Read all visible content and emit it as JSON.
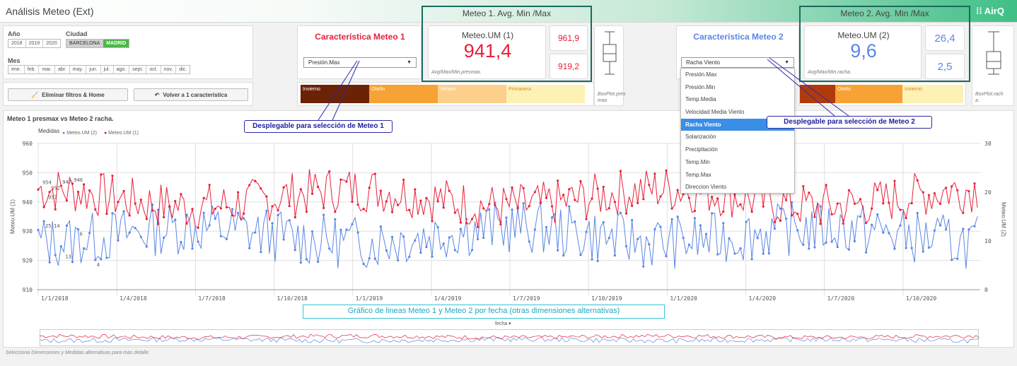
{
  "app": {
    "title": "Análisis Meteo (Ext)",
    "logo": "AirQ"
  },
  "filters": {
    "year_label": "Año",
    "years": [
      "2018",
      "2019",
      "2020"
    ],
    "city_label": "Ciudad",
    "cities": [
      "BARCELONA",
      "MADRID"
    ],
    "selected_city": "MADRID",
    "month_label": "Mes",
    "months": [
      "ene.",
      "feb.",
      "mar.",
      "abr.",
      "may.",
      "jun.",
      "jul.",
      "ago.",
      "sept.",
      "oct.",
      "nov.",
      "dic."
    ]
  },
  "buttons": {
    "clear": "Eliminar filtros & Home",
    "back": "Volver a 1 característica"
  },
  "meteo1": {
    "header": "Meteo 1. Avg. Min /Max",
    "char_title": "Característica Meteo 1",
    "selected": "Presión.Max",
    "kpi_label": "Meteo.UM (1)",
    "kpi_value": "941,4",
    "max": "961,9",
    "min": "919,2",
    "caption": "Avg/Max/Min.presmax.",
    "boxplot_caption": "BoxPlot.pres max.",
    "seasons": [
      "Invierno",
      "Otoño",
      "Verano",
      "Primavera"
    ],
    "color": "#e8203a"
  },
  "meteo2": {
    "header": "Meteo 2. Avg. Min /Max",
    "char_title": "Característica Meteo 2",
    "selected": "Racha Viento",
    "kpi_label": "Meteo.UM (2)",
    "kpi_value": "9,6",
    "max": "26,4",
    "min": "2,5",
    "caption": "Avg/Max/Min.racha.",
    "boxplot_caption": "BoxPlot.rach a.",
    "seasons": [
      "Otoño",
      "Invierno"
    ],
    "options": [
      "Presión.Max",
      "Presión.Min",
      "Temp.Media",
      "Velocidad Media Viento",
      "Racha Viento",
      "Solarización",
      "Precipitación",
      "Temp.Min",
      "Temp.Max",
      "Direccion Viento"
    ],
    "color": "#5b86e5"
  },
  "callouts": {
    "m1": "Desplegable para selección de Meteo 1",
    "m2": "Desplegable para selección de Meteo 2",
    "chart": "Gráfico de lineas Meteo 1 y Meteo 2 por fecha (otras dimensiones alternativas)"
  },
  "chart_title": "Meteo 1 presmax vs Meteo 2 racha.",
  "footer": "Selecciona Dimensiones y Medidas alternativas para mas detalle.",
  "chart_data": {
    "type": "line",
    "legend_title": "Medidas",
    "xlabel": "fecha",
    "ylabel_left": "Meteo.UM (1)",
    "ylabel_right": "Meteo.UM (2)",
    "x_tick_labels": [
      "1/1/2018",
      "1/4/2018",
      "1/7/2018",
      "1/10/2018",
      "1/1/2019",
      "1/4/2019",
      "1/7/2019",
      "1/10/2019",
      "1/1/2020",
      "1/4/2020",
      "1/7/2020",
      "1/10/2020"
    ],
    "y_left_ticks": [
      "960",
      "950",
      "940",
      "930",
      "920",
      "910"
    ],
    "y_right_ticks": [
      "30",
      "20",
      "10",
      "0"
    ],
    "ylim_left": [
      910,
      960
    ],
    "ylim_right": [
      0,
      30
    ],
    "grid": true,
    "series": [
      {
        "name": "Meteo.UM (2)",
        "axis": "right",
        "color": "#5b86e5",
        "mean": 9.6,
        "min": 2.5,
        "max": 26.4,
        "sample_labels": [
          {
            "i": 2,
            "v": "25"
          },
          {
            "i": 5,
            "v": "14"
          },
          {
            "i": 9,
            "v": "13"
          },
          {
            "i": 14,
            "v": "6"
          },
          {
            "i": 20,
            "v": "4"
          }
        ]
      },
      {
        "name": "Meteo.UM (1)",
        "axis": "left",
        "color": "#e8203a",
        "mean": 941.4,
        "min": 919.2,
        "max": 961.9,
        "sample_labels": [
          {
            "i": 1,
            "v": "954"
          },
          {
            "i": 3,
            "v": "957"
          },
          {
            "i": 4,
            "v": "952"
          },
          {
            "i": 8,
            "v": "947"
          },
          {
            "i": 12,
            "v": "946"
          }
        ]
      }
    ]
  }
}
